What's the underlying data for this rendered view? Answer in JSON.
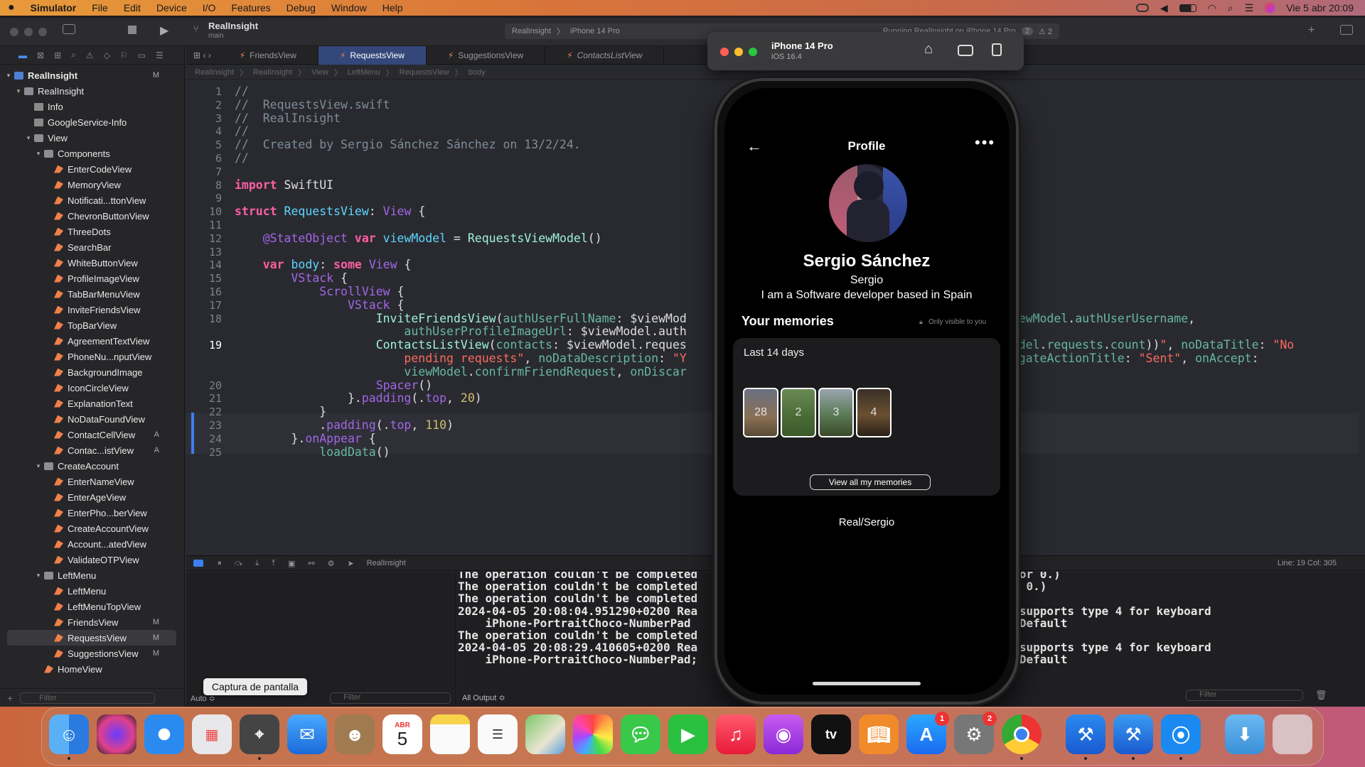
{
  "menubar": {
    "app_name": "Simulator",
    "items": [
      "File",
      "Edit",
      "Device",
      "I/O",
      "Features",
      "Debug",
      "Window",
      "Help"
    ],
    "datetime": "Vie 5 abr 20:09"
  },
  "xcode": {
    "scheme_title": "RealInsight",
    "branch": "main",
    "destination_project": "RealInsight",
    "destination_device": "iPhone 14 Pro",
    "status_text": "Running RealInsight on iPhone 14 Pro",
    "status_count": "2",
    "warning_count": "2",
    "tabs": [
      {
        "label": "FriendsView",
        "active": false,
        "italic": false
      },
      {
        "label": "RequestsView",
        "active": true,
        "italic": false
      },
      {
        "label": "SuggestionsView",
        "active": false,
        "italic": false
      },
      {
        "label": "ContactsListView",
        "active": false,
        "italic": true
      }
    ],
    "jumpbar": [
      "RealInsight",
      "RealInsight",
      "View",
      "LeftMenu",
      "RequestsView",
      "body"
    ],
    "navigator": [
      {
        "label": "RealInsight",
        "depth": 0,
        "icon": "proj",
        "disclosure": "down",
        "badge": "M"
      },
      {
        "label": "RealInsight",
        "depth": 1,
        "icon": "folder",
        "disclosure": "down",
        "badge": ""
      },
      {
        "label": "Info",
        "depth": 2,
        "icon": "plist",
        "disclosure": "",
        "badge": ""
      },
      {
        "label": "GoogleService-Info",
        "depth": 2,
        "icon": "plist",
        "disclosure": "",
        "badge": ""
      },
      {
        "label": "View",
        "depth": 2,
        "icon": "folder",
        "disclosure": "down",
        "badge": ""
      },
      {
        "label": "Components",
        "depth": 3,
        "icon": "folder",
        "disclosure": "down",
        "badge": ""
      },
      {
        "label": "EnterCodeView",
        "depth": 4,
        "icon": "swift",
        "disclosure": "",
        "badge": ""
      },
      {
        "label": "MemoryView",
        "depth": 4,
        "icon": "swift",
        "disclosure": "",
        "badge": ""
      },
      {
        "label": "Notificati...ttonView",
        "depth": 4,
        "icon": "swift",
        "disclosure": "",
        "badge": ""
      },
      {
        "label": "ChevronButtonView",
        "depth": 4,
        "icon": "swift",
        "disclosure": "",
        "badge": ""
      },
      {
        "label": "ThreeDots",
        "depth": 4,
        "icon": "swift",
        "disclosure": "",
        "badge": ""
      },
      {
        "label": "SearchBar",
        "depth": 4,
        "icon": "swift",
        "disclosure": "",
        "badge": ""
      },
      {
        "label": "WhiteButtonView",
        "depth": 4,
        "icon": "swift",
        "disclosure": "",
        "badge": ""
      },
      {
        "label": "ProfileImageView",
        "depth": 4,
        "icon": "swift",
        "disclosure": "",
        "badge": ""
      },
      {
        "label": "TabBarMenuView",
        "depth": 4,
        "icon": "swift",
        "disclosure": "",
        "badge": ""
      },
      {
        "label": "InviteFriendsView",
        "depth": 4,
        "icon": "swift",
        "disclosure": "",
        "badge": ""
      },
      {
        "label": "TopBarView",
        "depth": 4,
        "icon": "swift",
        "disclosure": "",
        "badge": ""
      },
      {
        "label": "AgreementTextView",
        "depth": 4,
        "icon": "swift",
        "disclosure": "",
        "badge": ""
      },
      {
        "label": "PhoneNu...nputView",
        "depth": 4,
        "icon": "swift",
        "disclosure": "",
        "badge": ""
      },
      {
        "label": "BackgroundImage",
        "depth": 4,
        "icon": "swift",
        "disclosure": "",
        "badge": ""
      },
      {
        "label": "IconCircleView",
        "depth": 4,
        "icon": "swift",
        "disclosure": "",
        "badge": ""
      },
      {
        "label": "ExplanationText",
        "depth": 4,
        "icon": "swift",
        "disclosure": "",
        "badge": ""
      },
      {
        "label": "NoDataFoundView",
        "depth": 4,
        "icon": "swift",
        "disclosure": "",
        "badge": ""
      },
      {
        "label": "ContactCellView",
        "depth": 4,
        "icon": "swift",
        "disclosure": "",
        "badge": "A"
      },
      {
        "label": "Contac...istView",
        "depth": 4,
        "icon": "swift",
        "disclosure": "",
        "badge": "A"
      },
      {
        "label": "CreateAccount",
        "depth": 3,
        "icon": "folder",
        "disclosure": "down",
        "badge": ""
      },
      {
        "label": "EnterNameView",
        "depth": 4,
        "icon": "swift",
        "disclosure": "",
        "badge": ""
      },
      {
        "label": "EnterAgeView",
        "depth": 4,
        "icon": "swift",
        "disclosure": "",
        "badge": ""
      },
      {
        "label": "EnterPho...berView",
        "depth": 4,
        "icon": "swift",
        "disclosure": "",
        "badge": ""
      },
      {
        "label": "CreateAccountView",
        "depth": 4,
        "icon": "swift",
        "disclosure": "",
        "badge": ""
      },
      {
        "label": "Account...atedView",
        "depth": 4,
        "icon": "swift",
        "disclosure": "",
        "badge": ""
      },
      {
        "label": "ValidateOTPView",
        "depth": 4,
        "icon": "swift",
        "disclosure": "",
        "badge": ""
      },
      {
        "label": "LeftMenu",
        "depth": 3,
        "icon": "folder",
        "disclosure": "down",
        "badge": ""
      },
      {
        "label": "LeftMenu",
        "depth": 4,
        "icon": "swift",
        "disclosure": "",
        "badge": ""
      },
      {
        "label": "LeftMenuTopView",
        "depth": 4,
        "icon": "swift",
        "disclosure": "",
        "badge": ""
      },
      {
        "label": "FriendsView",
        "depth": 4,
        "icon": "swift",
        "disclosure": "",
        "badge": "M"
      },
      {
        "label": "RequestsView",
        "depth": 4,
        "icon": "swift",
        "disclosure": "",
        "badge": "M",
        "selected": true
      },
      {
        "label": "SuggestionsView",
        "depth": 4,
        "icon": "swift",
        "disclosure": "",
        "badge": "M"
      },
      {
        "label": "HomeView",
        "depth": 3,
        "icon": "swift",
        "disclosure": "",
        "badge": ""
      }
    ],
    "nav_filter_placeholder": "Filter",
    "code_lines": [
      {
        "n": "1",
        "html": "<span class='cm'>//</span>"
      },
      {
        "n": "2",
        "html": "<span class='cm'>//  RequestsView.swift</span>"
      },
      {
        "n": "3",
        "html": "<span class='cm'>//  RealInsight</span>"
      },
      {
        "n": "4",
        "html": "<span class='cm'>//</span>"
      },
      {
        "n": "5",
        "html": "<span class='cm'>//  Created by Sergio Sánchez Sánchez on 13/2/24.</span>"
      },
      {
        "n": "6",
        "html": "<span class='cm'>//</span>"
      },
      {
        "n": "7",
        "html": ""
      },
      {
        "n": "8",
        "html": "<span class='kw'>import</span> SwiftUI"
      },
      {
        "n": "9",
        "html": ""
      },
      {
        "n": "10",
        "html": "<span class='kw'>struct</span> <span class='ty'>RequestsView</span>: <span class='pr'>View</span> {"
      },
      {
        "n": "11",
        "html": ""
      },
      {
        "n": "12",
        "html": "    <span class='pr'>@StateObject</span> <span class='kw'>var</span> <span class='ty'>viewModel</span> = <span class='tp2'>RequestsViewModel</span>()"
      },
      {
        "n": "13",
        "html": ""
      },
      {
        "n": "14",
        "html": "    <span class='kw'>var</span> <span class='ty'>body</span>: <span class='kw'>some</span> <span class='pr'>View</span> {"
      },
      {
        "n": "15",
        "html": "        <span class='pr'>VStack</span> {"
      },
      {
        "n": "16",
        "html": "            <span class='pr'>ScrollView</span> {"
      },
      {
        "n": "17",
        "html": "                <span class='pr'>VStack</span> {"
      },
      {
        "n": "18",
        "html": "                    <span class='tp2'>InviteFriendsView</span>(<span class='fn'>authUserFullName</span>: $viewMod                                              <span class='fn'>iewModel</span>.<span class='fn'>authUserUsername</span>,"
      },
      {
        "n": "",
        "html": "                        <span class='fn'>authUserProfileImageUrl</span>: $viewModel.auth"
      },
      {
        "n": "19",
        "html": "                    <span class='tp2'>ContactsListView</span>(<span class='fn'>contacts</span>: $viewModel.reques                                              <span class='fn'>odel</span>.<span class='fn'>requests</span>.<span class='fn'>count</span>))<span class='st'>\"</span>, <span class='fn'>noDataTitle</span>: <span class='st'>\"No</span>"
      },
      {
        "n": "",
        "html": "                        <span class='st'>pending requests\"</span>, <span class='fn'>noDataDescription</span>: <span class='st'>\"Y</span>                                              <span class='fn'>igateActionTitle</span>: <span class='st'>\"Sent\"</span>, <span class='fn'>onAccept</span>:"
      },
      {
        "n": "",
        "html": "                        <span class='fn'>viewModel</span>.<span class='fn'>confirmFriendRequest</span>, <span class='fn'>onDiscar</span>"
      },
      {
        "n": "20",
        "html": "                    <span class='pr'>Spacer</span>()"
      },
      {
        "n": "21",
        "html": "                }.<span class='pr'>padding</span>(.<span class='pr'>top</span>, <span class='nm'>20</span>)"
      },
      {
        "n": "22",
        "html": "            }"
      },
      {
        "n": "23",
        "html": "            .<span class='pr'>padding</span>(.<span class='pr'>top</span>, <span class='nm'>110</span>)"
      },
      {
        "n": "24",
        "html": "        }.<span class='pr'>onAppear</span> {"
      },
      {
        "n": "25",
        "html": "            <span class='fn'>loadData</span>()"
      }
    ],
    "debug_target": "RealInsight",
    "cursor_position": "Line: 19  Col: 305",
    "console_lines": [
      "The operation couldn't be completed                                         or error 0.)",
      "The operation couldn't be completed                                          error 0.)",
      "The operation couldn't be completed                                         0.)",
      "2024-04-05 20:08:04.951290+0200 Rea                                          that supports type 4 for keyboard",
      "    iPhone-PortraitChoco-NumberPad                                           -Pad_Default",
      "The operation couldn't be completed                                         0.)",
      "2024-04-05 20:08:29.410605+0200 Rea                                          that supports type 4 for keyboard",
      "    iPhone-PortraitChoco-NumberPad;                                          -Pad_Default"
    ],
    "console_filter_placeholder": "Filter",
    "output_selector": "All Output ≎",
    "auto_selector": "Auto ≎",
    "right_filter_placeholder": "Filter"
  },
  "simulator": {
    "device_name": "iPhone 14 Pro",
    "os_version": "iOS 16.4",
    "app": {
      "nav_title": "Profile",
      "full_name": "Sergio Sánchez",
      "username": "Sergio",
      "bio": "I am a Software developer based in Spain",
      "memories_title": "Your memories",
      "visibility_note": "Only visible to you",
      "card_period": "Last 14 days",
      "memory_days": [
        "28",
        "2",
        "3",
        "4"
      ],
      "view_all_button": "View all my memories",
      "footer_handle": "Real/Sergio"
    }
  },
  "dock": {
    "tooltip": "Captura de pantalla",
    "calendar_month": "ABR",
    "calendar_day": "5",
    "appstore_badge": "1",
    "settings_badge": "2"
  }
}
